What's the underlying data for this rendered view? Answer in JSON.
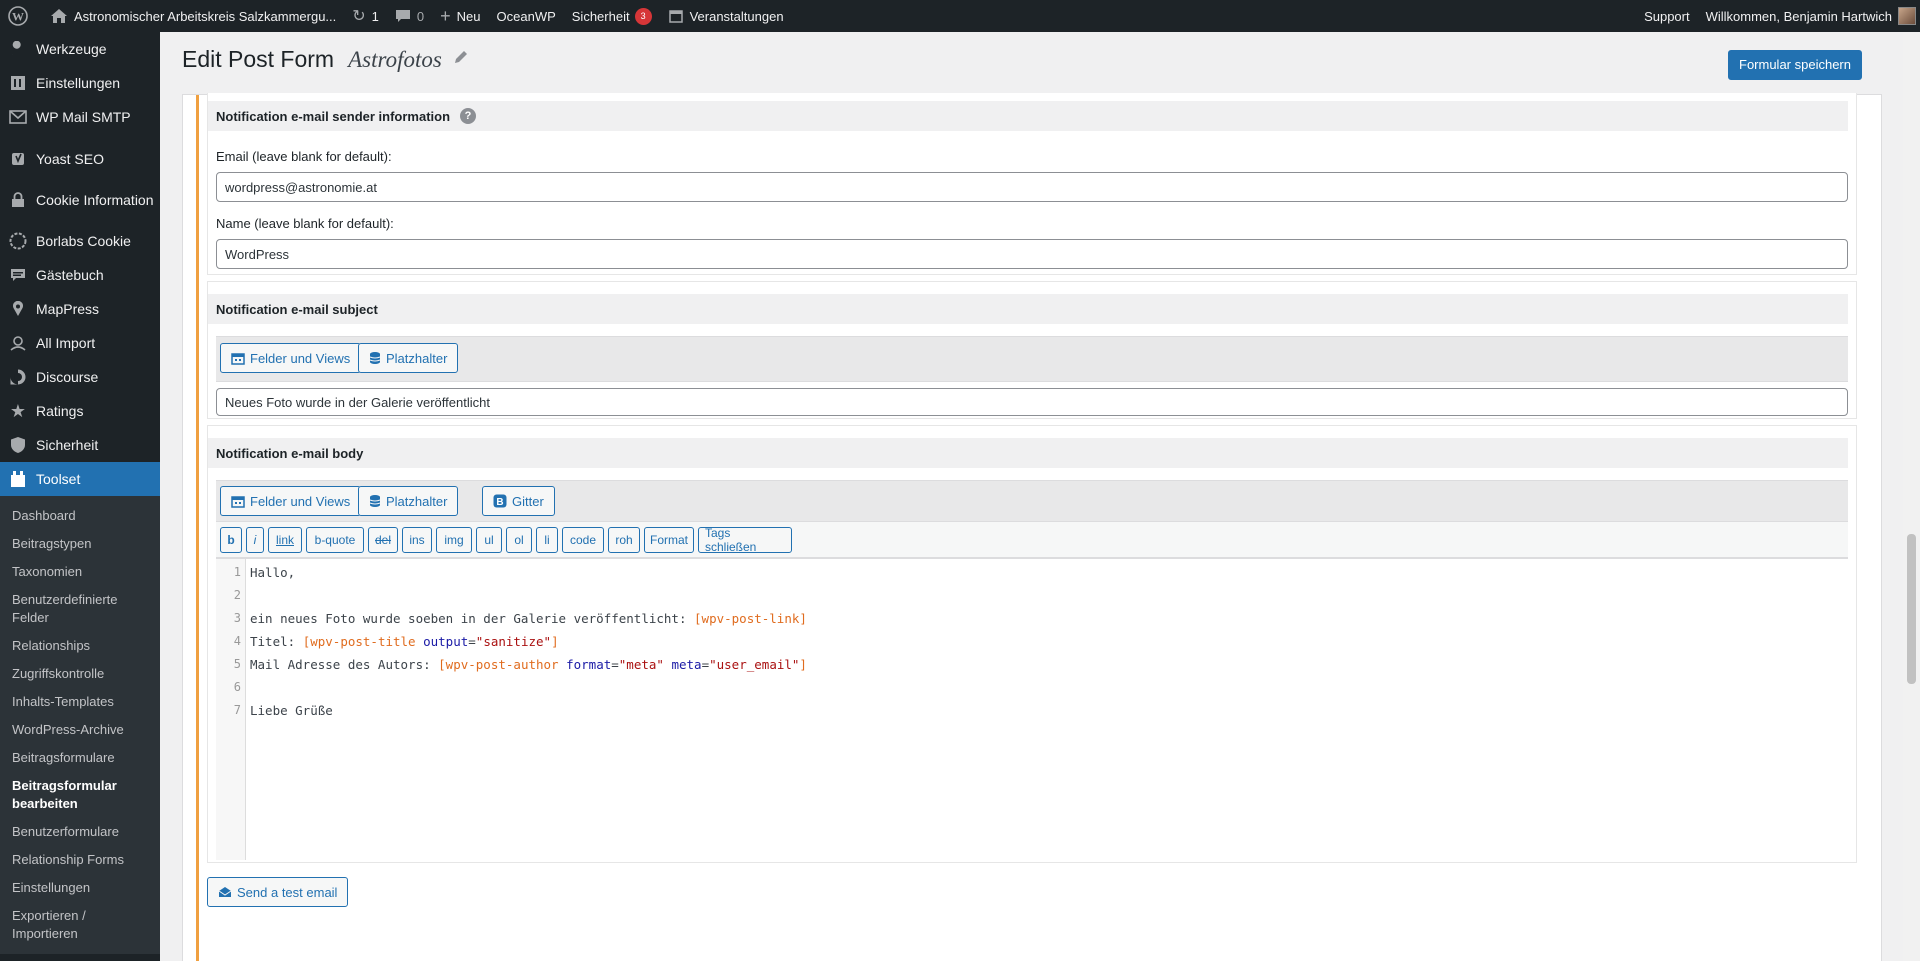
{
  "admin_bar": {
    "site_name": "Astronomischer Arbeitskreis Salzkammergu...",
    "updates_count": "1",
    "comments_count": "0",
    "new_label": "Neu",
    "theme_label": "OceanWP",
    "security_label": "Sicherheit",
    "security_badge": "3",
    "events_label": "Veranstaltungen",
    "support_label": "Support",
    "greeting": "Willkommen, Benjamin Hartwich"
  },
  "sidebar": {
    "items": [
      {
        "label": "Werkzeuge",
        "icon": "wrench-icon"
      },
      {
        "label": "Einstellungen",
        "icon": "settings-icon"
      },
      {
        "label": "WP Mail SMTP",
        "icon": "mail-icon"
      },
      {
        "label": "Yoast SEO",
        "icon": "yoast-icon"
      },
      {
        "label": "Cookie Information",
        "icon": "lock-icon"
      },
      {
        "label": "Borlabs Cookie",
        "icon": "cookie-icon"
      },
      {
        "label": "Gästebuch",
        "icon": "comment-icon"
      },
      {
        "label": "MapPress",
        "icon": "location-icon"
      },
      {
        "label": "All Import",
        "icon": "import-icon"
      },
      {
        "label": "Discourse",
        "icon": "discourse-icon"
      },
      {
        "label": "Ratings",
        "icon": "star-icon"
      },
      {
        "label": "Sicherheit",
        "icon": "shield-icon"
      },
      {
        "label": "Toolset",
        "icon": "toolset-icon"
      }
    ],
    "submenu": [
      "Dashboard",
      "Beitragstypen",
      "Taxonomien",
      "Benutzerdefinierte Felder",
      "Relationships",
      "Zugriffskontrolle",
      "Inhalts-Templates",
      "WordPress-Archive",
      "Beitragsformulare",
      "Beitragsformular bearbeiten",
      "Benutzerformulare",
      "Relationship Forms",
      "Einstellungen",
      "Exportieren / Importieren"
    ]
  },
  "header": {
    "title": "Edit Post Form",
    "post_title": "Astrofotos",
    "save_label": "Formular speichern"
  },
  "sender": {
    "heading": "Notification e-mail sender information",
    "email_label": "Email (leave blank for default):",
    "email_value": "wordpress@astronomie.at",
    "name_label": "Name (leave blank for default):",
    "name_value": "WordPress"
  },
  "subject": {
    "heading": "Notification e-mail subject",
    "fields_button": "Felder und Views",
    "placeholder_button": "Platzhalter",
    "value": "Neues Foto wurde in der Galerie veröffentlicht"
  },
  "body": {
    "heading": "Notification e-mail body",
    "fields_button": "Felder und Views",
    "placeholder_button": "Platzhalter",
    "grid_button": "Gitter",
    "quicktags": [
      "b",
      "i",
      "link",
      "b-quote",
      "del",
      "ins",
      "img",
      "ul",
      "ol",
      "li",
      "code",
      "roh",
      "Format",
      "Tags schließen"
    ],
    "line_numbers": [
      "1",
      "2",
      "3",
      "4",
      "5",
      "6",
      "7"
    ],
    "lines": {
      "l1": "Hallo,",
      "l3_text": "ein neues Foto wurde soeben in der Galerie veröffentlicht: ",
      "l3_sc": "[wpv-post-link]",
      "l4_text": "Titel: ",
      "l4_sc_open": "[wpv-post-title ",
      "l4_attr": "output",
      "l4_eq": "=",
      "l4_str": "\"sanitize\"",
      "l4_sc_close": "]",
      "l5_text": "Mail Adresse des Autors: ",
      "l5_sc_open": "[wpv-post-author ",
      "l5_attr1": "format",
      "l5_eq1": "=",
      "l5_str1": "\"meta\"",
      "l5_attr2": "meta",
      "l5_eq2": "=",
      "l5_str2": "\"user_email\"",
      "l5_sc_close": "]",
      "l7": "Liebe Grüße"
    },
    "test_email_button": "Send a test email"
  },
  "colors": {
    "accent": "#2271b1",
    "sidebar_bg": "#1d2327",
    "section_marker": "#f0a040",
    "shortcode": "#e06c1f"
  }
}
